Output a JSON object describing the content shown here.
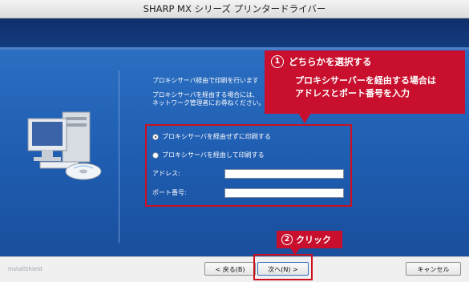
{
  "window": {
    "title": "SHARP MX シリーズ プリンタードライバー"
  },
  "content": {
    "intro_line1": "プロキシサーバ経由で印刷を行います",
    "intro_line2a": "プロキシサーバを経由する場合には、",
    "intro_line2b": "ネットワーク管理者にお尋ねください。"
  },
  "options": {
    "direct_label": "プロキシサーバを経由せずに印刷する",
    "proxy_label": "プロキシサーバを経由して印刷する",
    "selected": "direct"
  },
  "fields": {
    "address_label": "アドレス:",
    "address_value": "",
    "port_label": "ポート番号:",
    "port_value": ""
  },
  "annotations": {
    "step1_number": "1",
    "step1_title": "どちらかを選択する",
    "step1_body_line1": "プロキシサーバーを経由する場合は",
    "step1_body_line2": "アドレスとポート番号を入力",
    "step2_number": "2",
    "step2_title": "クリック"
  },
  "footer": {
    "brand": "InstallShield",
    "back_label": "< 戻る(B)",
    "next_label": "次へ(N) >",
    "cancel_label": "キャンセル"
  },
  "colors": {
    "accent_red": "#c8102e",
    "header_navy": "#0f2f6a",
    "panel_blue": "#2b6fc2"
  },
  "icons": {
    "computer": "computer-with-disc-icon"
  }
}
